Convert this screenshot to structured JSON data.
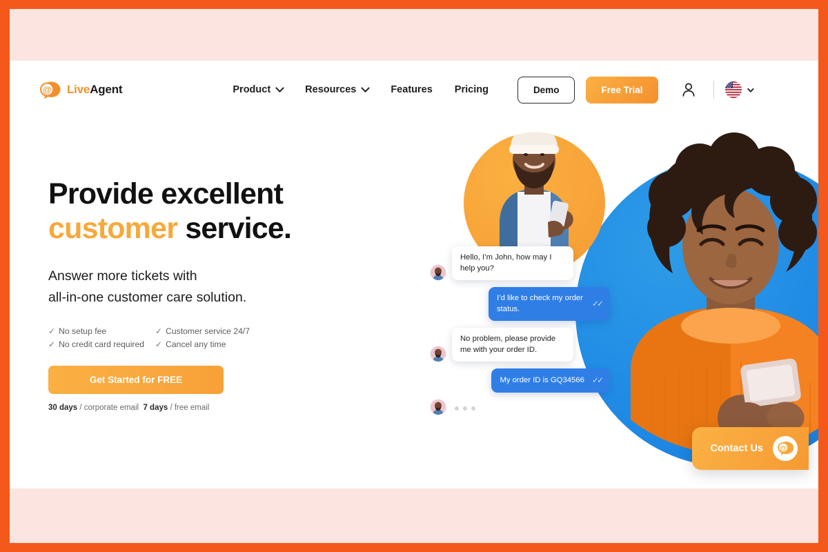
{
  "frame": {
    "border_color": "#F4581A",
    "band_color": "#FCE4E0"
  },
  "brand": {
    "logo_icon": "at-speech-bubble-icon",
    "name_first": "Live",
    "name_second": "Agent",
    "accent_color": "#F0912D"
  },
  "nav": {
    "items": [
      {
        "label": "Product",
        "has_dropdown": true
      },
      {
        "label": "Resources",
        "has_dropdown": true
      },
      {
        "label": "Features",
        "has_dropdown": false
      },
      {
        "label": "Pricing",
        "has_dropdown": false
      }
    ],
    "demo_label": "Demo",
    "free_trial_label": "Free Trial",
    "account_icon": "user-icon",
    "language_icon": "us-flag-icon",
    "language_chevron": "chevron-down-icon"
  },
  "hero": {
    "heading_line1": "Provide excellent",
    "heading_accent": "customer",
    "heading_rest": " service.",
    "sub_line1": "Answer more tickets with",
    "sub_line2": "all-in-one customer care solution.",
    "benefits": [
      "No setup fee",
      "Customer service 24/7",
      "No credit card required",
      "Cancel any time"
    ],
    "check_glyph": "✓",
    "cta_label": "Get Started for FREE",
    "fineprint": {
      "a_bold": "30 days",
      "a_rest": " / corporate email",
      "b_bold": "7 days",
      "b_rest": " / free email"
    }
  },
  "chat": {
    "messages": [
      {
        "from": "agent",
        "text": "Hello, I’m John, how may I help you?"
      },
      {
        "from": "customer",
        "text": "I’d like to check my order status.",
        "read_receipt": "✓✓"
      },
      {
        "from": "agent",
        "text": "No problem, please provide me with your order ID."
      },
      {
        "from": "customer",
        "text": "My order ID is GQ34566",
        "read_receipt": "✓✓"
      },
      {
        "from": "agent",
        "text": "",
        "typing": true
      }
    ],
    "agent_bubble_color": "#FFFFFF",
    "customer_bubble_color": "#2F7EE6"
  },
  "widget": {
    "label": "Contact Us",
    "icon": "at-speech-bubble-icon"
  }
}
